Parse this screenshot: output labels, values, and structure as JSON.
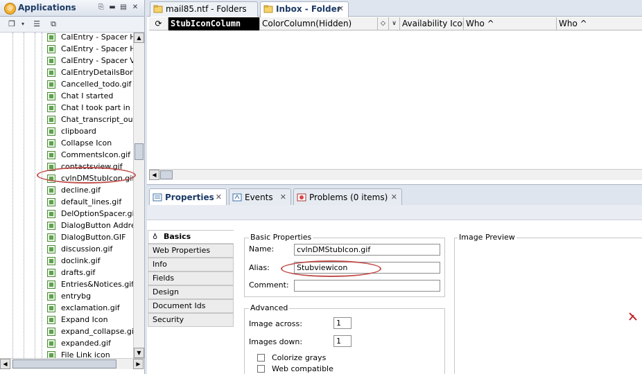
{
  "left_panel": {
    "title": "Applications",
    "tree_items": [
      "CalEntry - Spacer Hori",
      "CalEntry - Spacer Hori",
      "CalEntry - Spacer Ver",
      "CalEntryDetailsBorder",
      "Cancelled_todo.gif",
      "Chat I started",
      "Chat I took part in",
      "Chat_transcript_outli",
      "clipboard",
      "Collapse Icon",
      "CommentsIcon.gif",
      "contactsview.gif",
      "cvlnDMStubIcon.gif",
      "decline.gif",
      "default_lines.gif",
      "DelOptionSpacer.gif",
      "DialogButton Address",
      "DialogButton.GIF",
      "discussion.gif",
      "doclink.gif",
      "drafts.gif",
      "Entries&Notices.gif",
      "entrybg",
      "exclamation.gif",
      "Expand Icon",
      "expand_collapse.gif",
      "expanded.gif",
      "File Link icon"
    ]
  },
  "editor_tabs": [
    {
      "label": "mail85.ntf - Folders"
    },
    {
      "label": "Inbox - Folder"
    }
  ],
  "columns": [
    "StubIconColumn",
    "ColorColumn(Hidden)",
    "Availability Icon",
    "Who ^",
    "Who ^"
  ],
  "prop_tabs": [
    {
      "label": "Properties"
    },
    {
      "label": "Events"
    },
    {
      "label": "Problems (0 items)"
    }
  ],
  "sections": [
    "Basics",
    "Web Properties",
    "Info",
    "Fields",
    "Design",
    "Document Ids",
    "Security"
  ],
  "basic_properties": {
    "legend": "Basic Properties",
    "name_label": "Name:",
    "name_value": "cvlnDMStubIcon.gif",
    "alias_label": "Alias:",
    "alias_value": "Stubviewicon",
    "comment_label": "Comment:",
    "comment_value": ""
  },
  "advanced": {
    "legend": "Advanced",
    "across_label": "Image across:",
    "across_value": "1",
    "down_label": "Images down:",
    "down_value": "1",
    "colorize_label": "Colorize grays",
    "web_label": "Web compatible"
  },
  "preview": {
    "legend": "Image Preview"
  },
  "colors": {
    "accent": "#1d3b66",
    "highlight_oval": "#c0504d",
    "tab_bg": "#dfe5ee"
  }
}
